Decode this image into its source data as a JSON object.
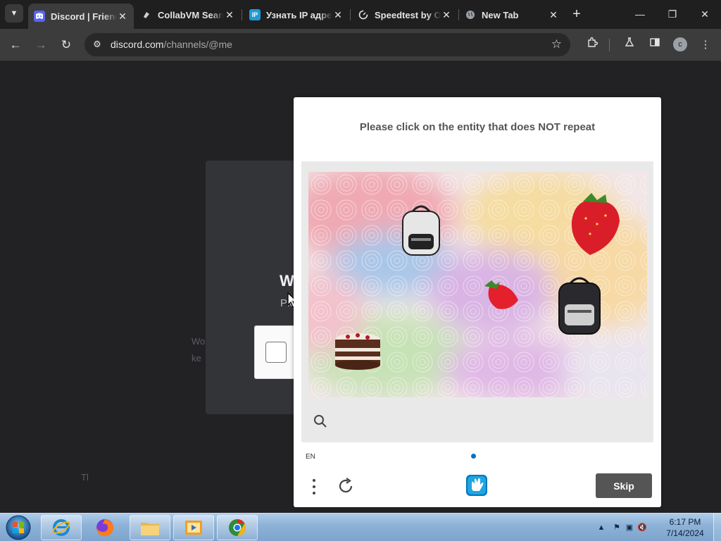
{
  "browser": {
    "tabs": [
      {
        "title": "Discord | Friends",
        "favicon": "discord-icon",
        "active": true
      },
      {
        "title": "CollabVM Search",
        "favicon": "collabvm-icon",
        "active": false
      },
      {
        "title": "Узнать IP адрес",
        "favicon": "ip-icon",
        "active": false
      },
      {
        "title": "Speedtest by Ookla",
        "favicon": "speedtest-icon",
        "active": false
      },
      {
        "title": "New Tab",
        "favicon": "globe-icon",
        "active": false
      }
    ],
    "url_host": "discord.com",
    "url_path": "/channels/@me",
    "profile_initial": "c"
  },
  "page": {
    "card_title_fragment": "W",
    "card_sub_fragment": "Ple",
    "card_left_line1": "Wo",
    "card_left_line2": "ke",
    "card_bottom_fragment": "Tl"
  },
  "captcha": {
    "prompt": "Please click on the entity that does NOT repeat",
    "language": "EN",
    "skip_label": "Skip",
    "brand_color": "#0074bf"
  },
  "taskbar": {
    "apps": [
      "internet-explorer-icon",
      "firefox-icon",
      "file-explorer-icon",
      "media-player-icon",
      "chrome-icon"
    ],
    "time": "6:17 PM",
    "date": "7/14/2024"
  }
}
